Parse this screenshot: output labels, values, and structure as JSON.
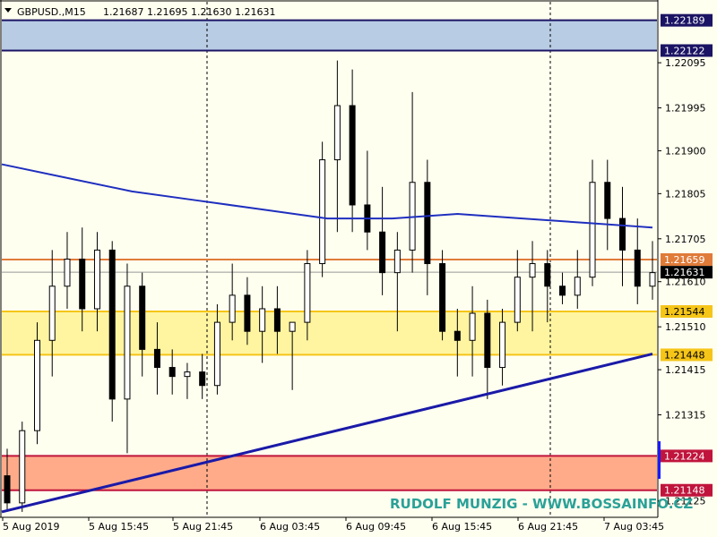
{
  "header": {
    "symbol": "GBPUSD.,M15",
    "ohlc": "1.21687 1.21695 1.21630 1.21631",
    "dropdown_icon": "triangle-down-icon"
  },
  "watermark": "RUDOLF MUNZIG - WWW.BOSSAINFO.CZ",
  "colors": {
    "background": "#fffff0",
    "candle": "#000000",
    "ma_line": "#1f2fbf",
    "trend_line": "#1a1aa8",
    "zone_blue": "#b8cce4",
    "zone_yellow": "#fff5a0",
    "zone_orange": "#ffab8a",
    "line_orange": "#e07b39",
    "line_yellow": "#f5c518",
    "line_red": "#c0143c",
    "line_navy": "#1b1464"
  },
  "chart_data": {
    "type": "candlestick",
    "symbol": "GBPUSD.",
    "timeframe": "M15",
    "ylim": [
      1.2109,
      1.2223
    ],
    "y_ticks": [
      "1.22095",
      "1.21995",
      "1.21900",
      "1.21805",
      "1.21705",
      "1.21610",
      "1.21510",
      "1.21415",
      "1.21315",
      "1.21220",
      "1.21125"
    ],
    "x_ticks": [
      "5 Aug 2019",
      "5 Aug 15:45",
      "5 Aug 21:45",
      "6 Aug 03:45",
      "6 Aug 09:45",
      "6 Aug 15:45",
      "6 Aug 21:45",
      "7 Aug 03:45"
    ],
    "grid": "vertical dotted separators",
    "price_levels": [
      {
        "value": 1.22189,
        "label": "1.22189",
        "style": "navy"
      },
      {
        "value": 1.22122,
        "label": "1.22122",
        "style": "navy"
      },
      {
        "value": 1.21659,
        "label": "1.21659",
        "style": "orange"
      },
      {
        "value": 1.21631,
        "label": "1.21631",
        "style": "current"
      },
      {
        "value": 1.21544,
        "label": "1.21544",
        "style": "yellow"
      },
      {
        "value": 1.21448,
        "label": "1.21448",
        "style": "yellow"
      },
      {
        "value": 1.21224,
        "label": "1.21224",
        "style": "red"
      },
      {
        "value": 1.21148,
        "label": "1.21148",
        "style": "red"
      }
    ],
    "zones": [
      {
        "from": 1.22122,
        "to": 1.22189,
        "color": "blue"
      },
      {
        "from": 1.21448,
        "to": 1.21544,
        "color": "yellow"
      },
      {
        "from": 1.21148,
        "to": 1.21224,
        "color": "orange"
      }
    ],
    "trendline": {
      "from": [
        0,
        1.211
      ],
      "to": [
        1,
        1.2145
      ]
    },
    "moving_average": [
      1.2187,
      1.2184,
      1.2181,
      1.2179,
      1.2177,
      1.2175,
      1.2175,
      1.2176,
      1.2175,
      1.2174,
      1.2173
    ],
    "candles": [
      {
        "o": 1.2118,
        "h": 1.2124,
        "l": 1.211,
        "c": 1.2112
      },
      {
        "o": 1.2112,
        "h": 1.213,
        "l": 1.211,
        "c": 1.2128
      },
      {
        "o": 1.2128,
        "h": 1.2152,
        "l": 1.2125,
        "c": 1.2148
      },
      {
        "o": 1.2148,
        "h": 1.2168,
        "l": 1.214,
        "c": 1.216
      },
      {
        "o": 1.216,
        "h": 1.2172,
        "l": 1.2155,
        "c": 1.2166
      },
      {
        "o": 1.2166,
        "h": 1.2173,
        "l": 1.215,
        "c": 1.2155
      },
      {
        "o": 1.2155,
        "h": 1.2172,
        "l": 1.215,
        "c": 1.2168
      },
      {
        "o": 1.2168,
        "h": 1.217,
        "l": 1.213,
        "c": 1.2135
      },
      {
        "o": 1.2135,
        "h": 1.2165,
        "l": 1.2123,
        "c": 1.216
      },
      {
        "o": 1.216,
        "h": 1.2163,
        "l": 1.214,
        "c": 1.2146
      },
      {
        "o": 1.2146,
        "h": 1.2152,
        "l": 1.2136,
        "c": 1.2142
      },
      {
        "o": 1.2142,
        "h": 1.2146,
        "l": 1.2136,
        "c": 1.214
      },
      {
        "o": 1.214,
        "h": 1.2143,
        "l": 1.2135,
        "c": 1.2141
      },
      {
        "o": 1.2141,
        "h": 1.2145,
        "l": 1.2135,
        "c": 1.2138
      },
      {
        "o": 1.2138,
        "h": 1.2156,
        "l": 1.2136,
        "c": 1.2152
      },
      {
        "o": 1.2152,
        "h": 1.2165,
        "l": 1.2148,
        "c": 1.2158
      },
      {
        "o": 1.2158,
        "h": 1.2162,
        "l": 1.2147,
        "c": 1.215
      },
      {
        "o": 1.215,
        "h": 1.216,
        "l": 1.2143,
        "c": 1.2155
      },
      {
        "o": 1.2155,
        "h": 1.216,
        "l": 1.2145,
        "c": 1.215
      },
      {
        "o": 1.215,
        "h": 1.2152,
        "l": 1.2137,
        "c": 1.2152
      },
      {
        "o": 1.2152,
        "h": 1.2168,
        "l": 1.2148,
        "c": 1.2165
      },
      {
        "o": 1.2165,
        "h": 1.2192,
        "l": 1.2162,
        "c": 1.2188
      },
      {
        "o": 1.2188,
        "h": 1.221,
        "l": 1.2172,
        "c": 1.22
      },
      {
        "o": 1.22,
        "h": 1.2208,
        "l": 1.2172,
        "c": 1.2178
      },
      {
        "o": 1.2178,
        "h": 1.219,
        "l": 1.2168,
        "c": 1.2172
      },
      {
        "o": 1.2172,
        "h": 1.2182,
        "l": 1.2158,
        "c": 1.2163
      },
      {
        "o": 1.2163,
        "h": 1.2172,
        "l": 1.215,
        "c": 1.2168
      },
      {
        "o": 1.2168,
        "h": 1.2203,
        "l": 1.2163,
        "c": 1.2183
      },
      {
        "o": 1.2183,
        "h": 1.2188,
        "l": 1.2158,
        "c": 1.2165
      },
      {
        "o": 1.2165,
        "h": 1.2168,
        "l": 1.2148,
        "c": 1.215
      },
      {
        "o": 1.215,
        "h": 1.2155,
        "l": 1.214,
        "c": 1.2148
      },
      {
        "o": 1.2148,
        "h": 1.216,
        "l": 1.214,
        "c": 1.2154
      },
      {
        "o": 1.2154,
        "h": 1.2157,
        "l": 1.2135,
        "c": 1.2142
      },
      {
        "o": 1.2142,
        "h": 1.2155,
        "l": 1.2138,
        "c": 1.2152
      },
      {
        "o": 1.2152,
        "h": 1.2168,
        "l": 1.215,
        "c": 1.2162
      },
      {
        "o": 1.2162,
        "h": 1.217,
        "l": 1.215,
        "c": 1.2165
      },
      {
        "o": 1.2165,
        "h": 1.2168,
        "l": 1.2152,
        "c": 1.216
      },
      {
        "o": 1.216,
        "h": 1.2163,
        "l": 1.2156,
        "c": 1.2158
      },
      {
        "o": 1.2158,
        "h": 1.2168,
        "l": 1.2155,
        "c": 1.2162
      },
      {
        "o": 1.2162,
        "h": 1.2188,
        "l": 1.216,
        "c": 1.2183
      },
      {
        "o": 1.2183,
        "h": 1.2188,
        "l": 1.2168,
        "c": 1.2175
      },
      {
        "o": 1.2175,
        "h": 1.2182,
        "l": 1.216,
        "c": 1.2168
      },
      {
        "o": 1.2168,
        "h": 1.2175,
        "l": 1.2156,
        "c": 1.216
      },
      {
        "o": 1.216,
        "h": 1.217,
        "l": 1.2157,
        "c": 1.2163
      }
    ]
  }
}
